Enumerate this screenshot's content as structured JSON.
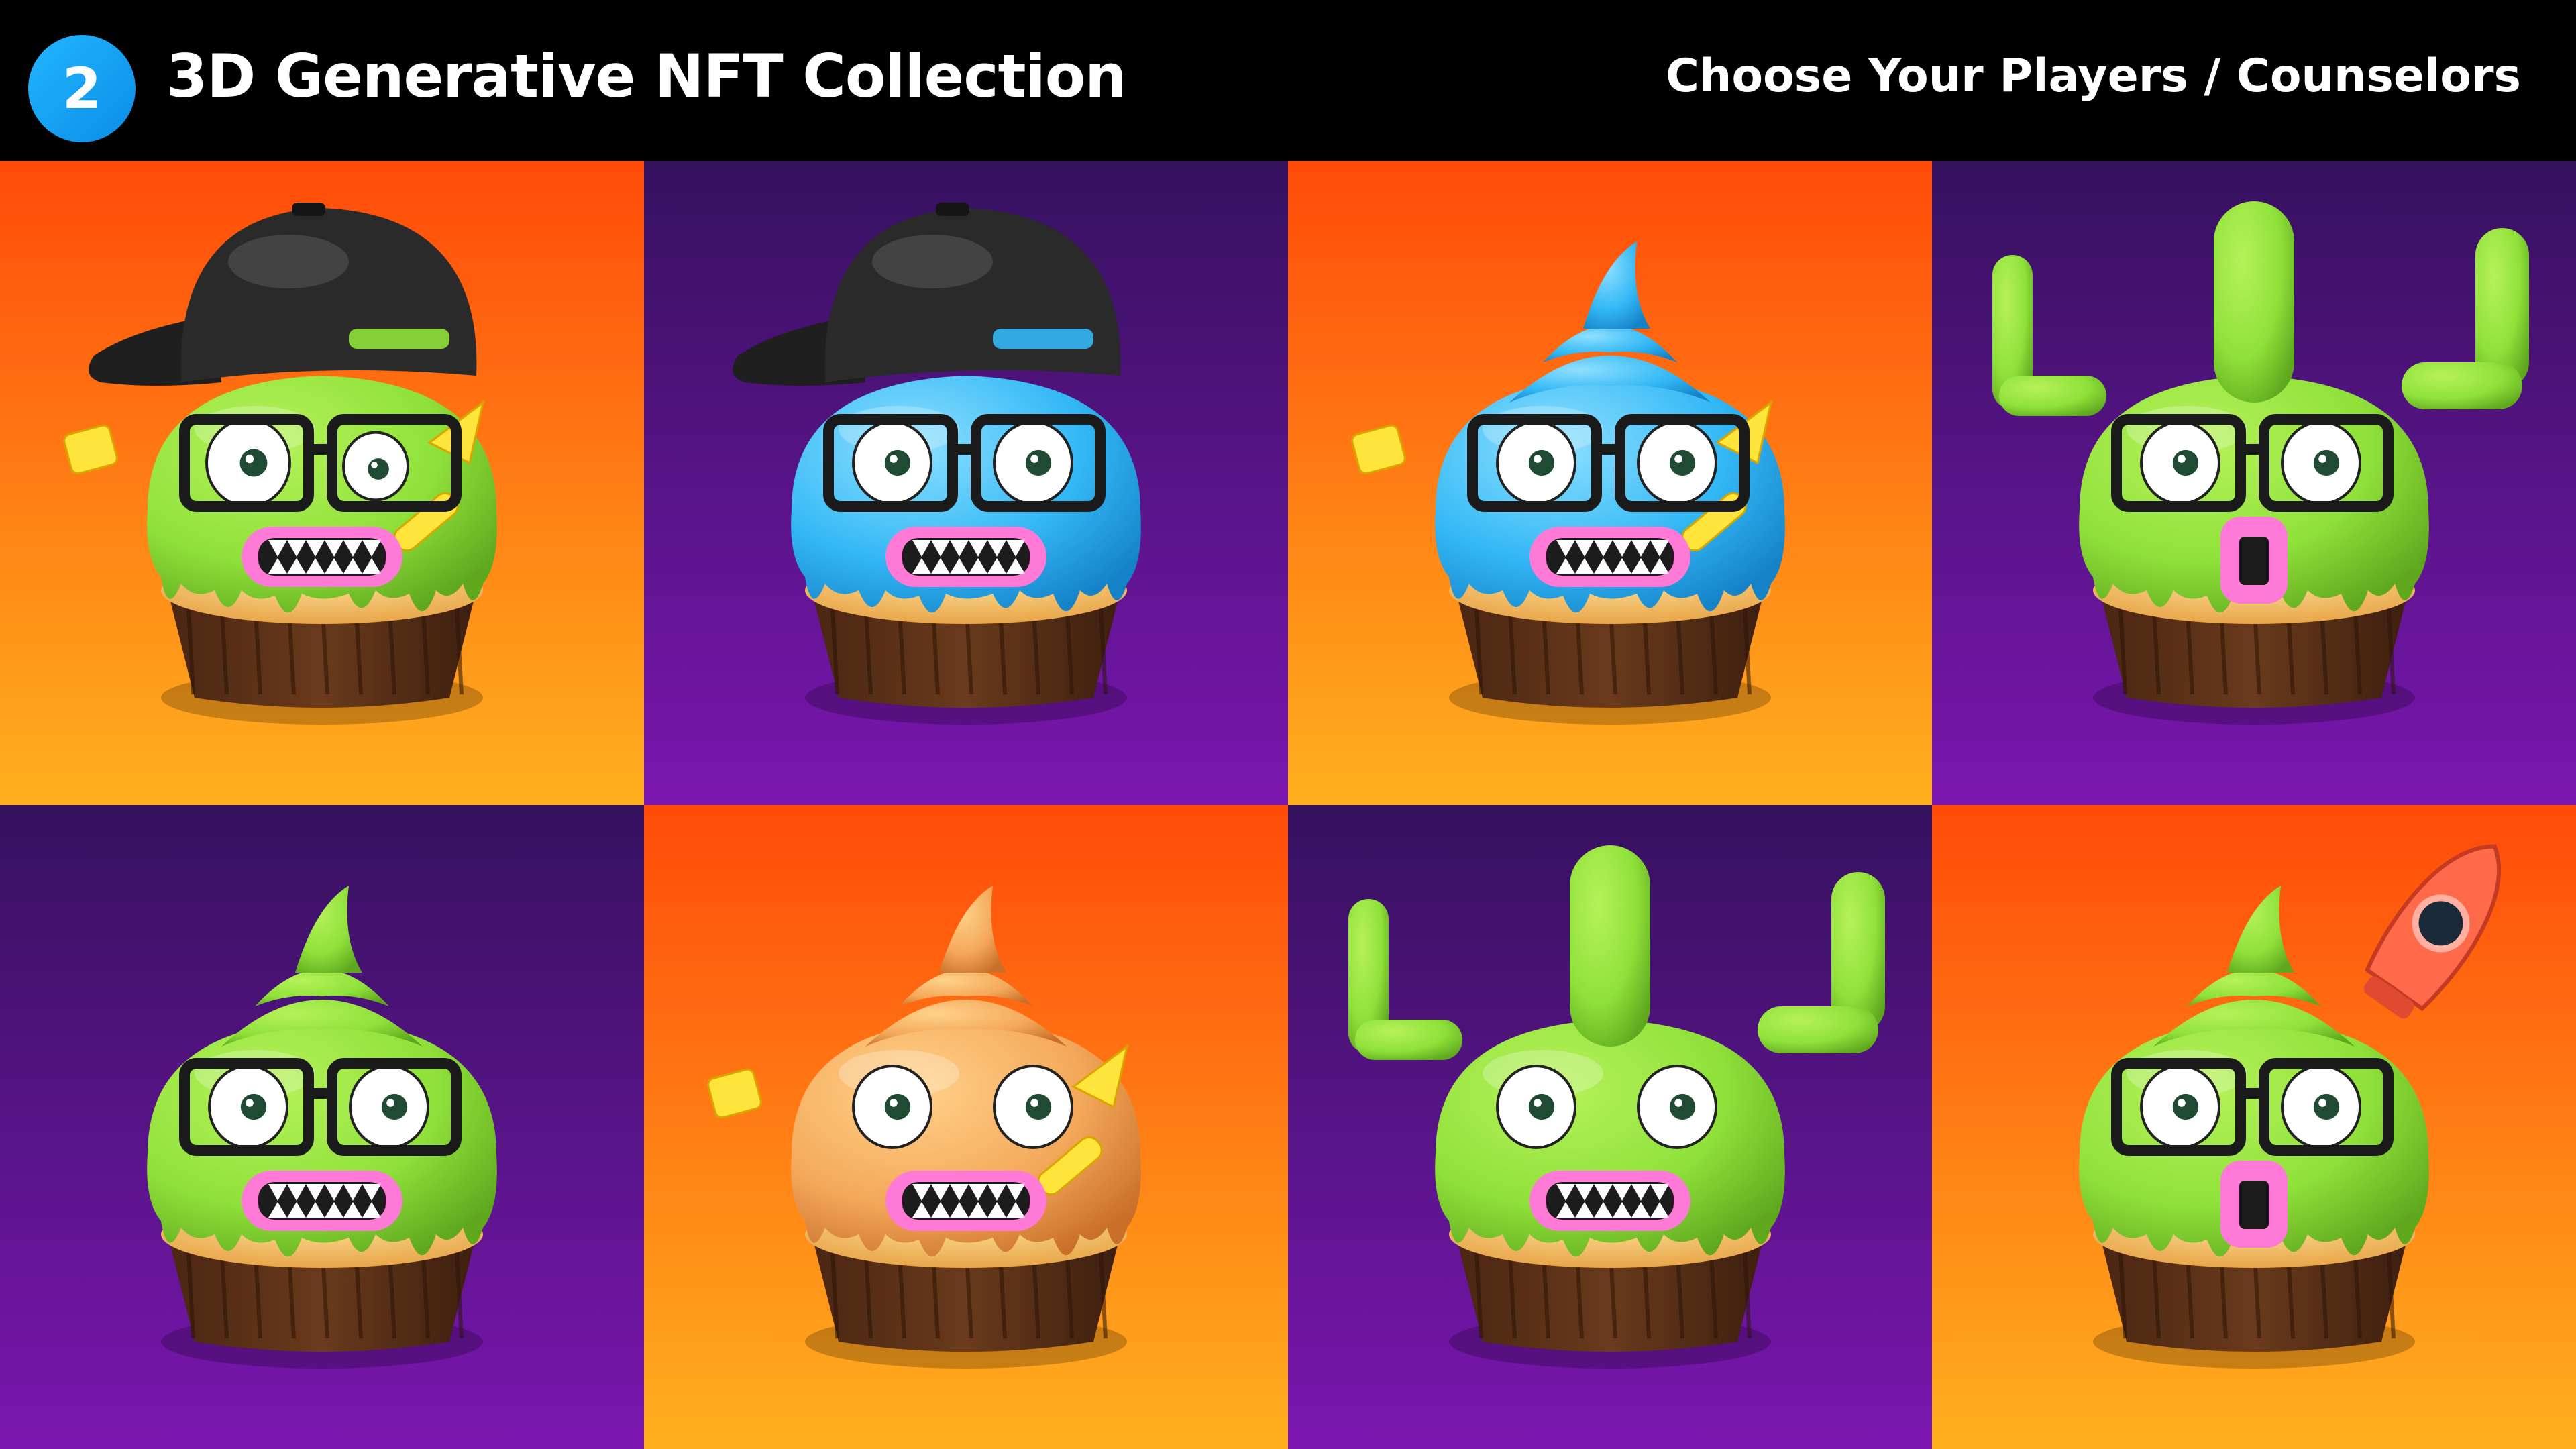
{
  "header": {
    "step_number": "2",
    "title": "3D Generative NFT Collection",
    "subtitle": "Choose Your Players / Counselors"
  },
  "colors": {
    "orange_bg_top": "#ff4a0a",
    "orange_bg_bottom": "#ffb01e",
    "purple_bg_top": "#35115e",
    "purple_bg_bottom": "#7a16b0",
    "green_frosting": "#8fe13a",
    "blue_frosting": "#33b8f5",
    "peach_frosting": "#f4a85a",
    "mouth_pink": "#ff7ad6",
    "liner_brown": "#6a3a1c",
    "sprinkle_yellow": "#ffe43c"
  },
  "tiles": [
    {
      "background": "orange",
      "frosting": "green",
      "hat": "cap",
      "glasses": true,
      "mouth": "teeth",
      "extra": "sprinkles",
      "eye_style": "wonky"
    },
    {
      "background": "purple",
      "frosting": "blue",
      "hat": "cap",
      "glasses": true,
      "mouth": "teeth",
      "extra": "none",
      "eye_style": "normal"
    },
    {
      "background": "orange",
      "frosting": "blue",
      "hat": "swirl",
      "glasses": true,
      "mouth": "teeth",
      "extra": "sprinkles",
      "eye_style": "normal"
    },
    {
      "background": "purple",
      "frosting": "green",
      "hat": "cactus",
      "glasses": true,
      "mouth": "o",
      "extra": "none",
      "eye_style": "normal"
    },
    {
      "background": "purple",
      "frosting": "green",
      "hat": "swirl",
      "glasses": true,
      "mouth": "teeth",
      "extra": "none",
      "eye_style": "normal"
    },
    {
      "background": "orange",
      "frosting": "peach",
      "hat": "swirl",
      "glasses": false,
      "mouth": "teeth",
      "extra": "sprinkles",
      "eye_style": "normal"
    },
    {
      "background": "purple",
      "frosting": "green",
      "hat": "cactus",
      "glasses": false,
      "mouth": "teeth",
      "extra": "none",
      "eye_style": "normal"
    },
    {
      "background": "orange",
      "frosting": "green",
      "hat": "swirl",
      "glasses": true,
      "mouth": "o",
      "extra": "rocket",
      "eye_style": "normal"
    }
  ]
}
